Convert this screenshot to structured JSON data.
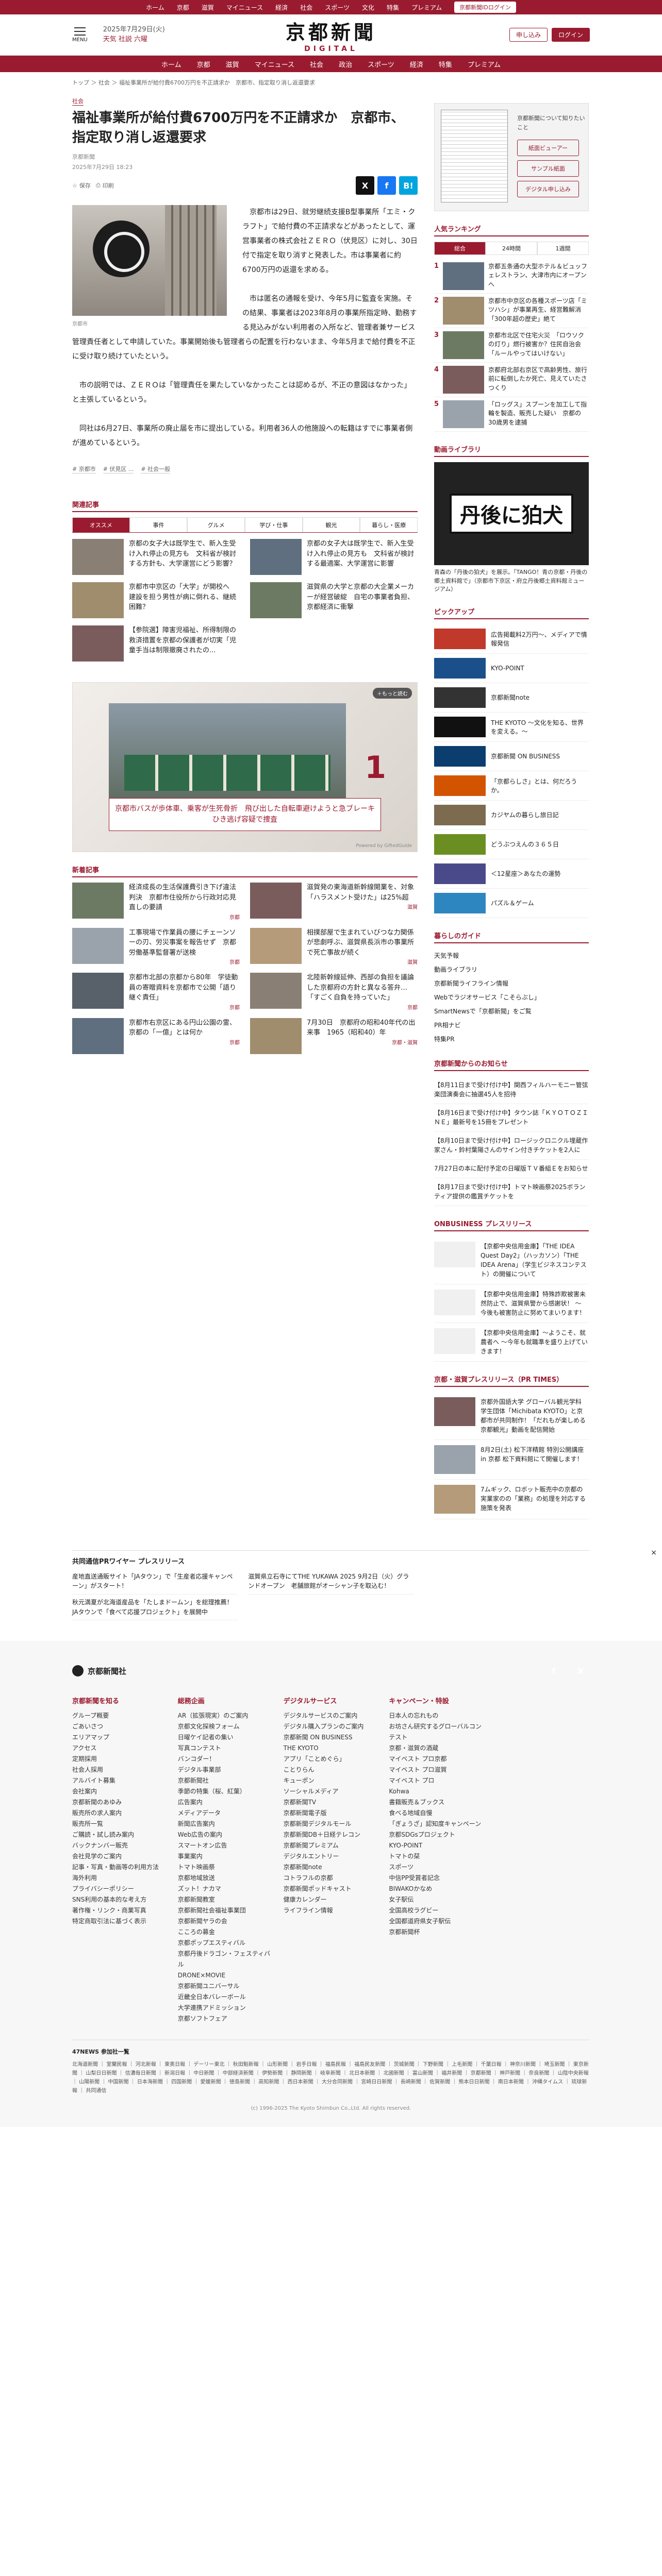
{
  "topnav": {
    "items": [
      "ホーム",
      "京都",
      "滋賀",
      "マイニュース",
      "経済",
      "社会",
      "スポーツ",
      "文化",
      "特集",
      "プレミアム"
    ],
    "login": "京都新聞IDログイン"
  },
  "header": {
    "menu": "MENU",
    "date": "2025年7月29日(火)",
    "weather_loc": "天気 社説 六曜",
    "logo": "京都新聞",
    "logo_sub": "DIGITAL",
    "subscribe": "申し込み",
    "login": "ログイン"
  },
  "catnav": [
    "ホーム",
    "京都",
    "滋賀",
    "マイニュース",
    "社会",
    "政治",
    "スポーツ",
    "経済",
    "特集",
    "プレミアム"
  ],
  "breadcrumb": "トップ ＞ 社会 ＞ 福祉事業所が給付費6700万円を不正請求か　京都市、指定取り消し返還要求",
  "article": {
    "tag": "社会",
    "title": "福祉事業所が給付費6700万円を不正請求か　京都市、指定取り消し返還要求",
    "author": "京都新聞",
    "date": "2025年7月29日 18:23",
    "save": "保存",
    "print": "印刷",
    "photo_caption": "京都市",
    "paragraphs": [
      "京都市は29日、就労継続支援B型事業所「エミ・クラフト」で給付費の不正請求などがあったとして、運営事業者の株式会社ＺＥＲＯ（伏見区）に対し、30日付で指定を取り消すと発表した。市は事業者に約6700万円の返還を求める。",
      "市は匿名の通報を受け、今年5月に監査を実施。その結果、事業者は2023年8月の事業所指定時、勤務する見込みがない利用者の入所など、管理者兼サービス管理責任者として申請していた。事業開始後も管理者らの配置を行わないまま、今年5月まで給付費を不正に受け取り続けていたという。",
      "市の説明では、ＺＥＲＯは「管理責任を果たしていなかったことは認めるが、不正の意図はなかった」と主張しているという。",
      "同社は6月27日、事業所の廃止届を市に提出している。利用者36人の他施設への転籍はすでに事業者側が進めているという。"
    ],
    "tags": [
      "# 京都市",
      "# 伏見区 ...",
      "# 社会一般"
    ]
  },
  "related": {
    "heading": "関連記事",
    "tabs": [
      "オススメ",
      "事件",
      "グルメ",
      "学び・仕事",
      "観光",
      "暮らし・医療"
    ],
    "items": [
      "京都の女子大は既学生で、新入生受け入れ停止の見方も　文科省が検討する方針も、大学運営にどう影響？",
      "京都の女子大は既学生で、新入生受け入れ停止の見方も　文科省が検討する最適案、大学運営に影響",
      "京都市中京区の「大学」が開校へ　建設を担う男性が病に倒れる、継続困難？",
      "滋賀県の大学と京都の大企業メーカーが経営破綻　自宅の事業者負担、京都経済に衝撃",
      "【参院選】障害児福祉、所得制限の救済措置を京都の保護者が切実「児童手当は制限撤廃されたの..."
    ]
  },
  "video": {
    "more": "＋もっと読む",
    "caption": "京都市バスが歩体車、乗客が生死骨折　飛び出した自転車避けようと急ブレーキ　ひき逃げ容疑で捜査",
    "number": "1",
    "powered": "Powered by GiftedGuide"
  },
  "latest": {
    "heading": "新着記事",
    "items": [
      {
        "t": "経済成長の生活保護費引き下げ違法判決　京都市住役所から行政対応見直しの要請",
        "c": "京都"
      },
      {
        "t": "滋賀発の東海道新幹線開業を、対象「ハラスメント受けた」は25%超",
        "c": "滋賀"
      },
      {
        "t": "工事現場で作業員の腰にチェーンソーの刃、労災事案を報告せず　京都労働基準監督署が送検",
        "c": "京都"
      },
      {
        "t": "相撲部屋で生まれていびつな力関係が悲劇呼ぶ、滋賀県長浜市の事業所で死亡事故が続く",
        "c": "滋賀"
      },
      {
        "t": "京都市北部の京都から80年　学徒動員の寄贈資料を京都市で公開「語り継ぐ責任」",
        "c": "京都"
      },
      {
        "t": "北陸新幹線延伸、西部の負担を議論した京都府の方針と異なる答弁…「すごく自負を持っていた」",
        "c": "京都"
      },
      {
        "t": "京都市右京区にある円山公園の霊、京都の「一億」とは何か",
        "c": "京都"
      },
      {
        "t": "7月30日　京都府の昭和40年代の出来事　1965（昭和40）年",
        "c": "京都・滋賀"
      }
    ]
  },
  "side": {
    "paper_desc": "京都新聞について知りたいこと",
    "btn1": "紙面ビューアー",
    "btn2": "サンプル紙面",
    "btn3": "デジタル申し込み",
    "ranking_heading": "人気ランキング",
    "ranking_tabs": [
      "総合",
      "24時間",
      "1週間"
    ],
    "ranking": [
      "京都五条通の大型ホテル＆ビュッフェレストラン、大津市内にオープンへ",
      "京都市中京区の各種スポーツ店「ミツハシ」が事業再生、経営難解消「300年超の歴史」絶て",
      "京都市北区で住宅火災　「ロウソクの灯り」燃行被害か？住民自治会「ルールやってはいけない」",
      "京都府北部右京区で高齢男性、旅行前に転倒したか死亡、見えていたさつくり",
      "「ロッグス」スプーンを加工して指輪を製造、販売した疑い　京都の30歳男を逮捕"
    ],
    "ranking_nums": [
      "1",
      "2",
      "3",
      "4",
      "5"
    ],
    "movie_heading": "動画ライブラリ",
    "movie_title": "丹後に狛犬",
    "movie_desc": "青森の「丹後の狛犬」を展示。「TANGO！青の京都・丹後の郷土資料館で」（京都市下京区・府立丹後郷土資料館ミュージアム）",
    "pickup_heading": "ピックアップ",
    "pickups": [
      "広告掲載料2万円〜、メディアで情報発信",
      "KYO-POINT",
      "京都新聞note",
      "THE KYOTO 〜文化を知る、世界を変える。〜",
      "京都新聞 ON BUSINESS",
      "「京都らしさ」とは、何だろうか。",
      "カジヤムの暮らし旅日記",
      "どうぶつえんの３６５日",
      "＜12星座＞あなたの運勢",
      "パズル＆ゲーム"
    ],
    "guide_heading": "暮らしのガイド",
    "guides": [
      "天気予報",
      "動画ライブラリ",
      "京都新聞ライフライン情報",
      "Webでラジオサービス「こそらぶし」",
      "SmartNewsで「京都新聞」をご覧",
      "PR相ナビ",
      "特集PR"
    ],
    "notice_heading": "京都新聞からのお知らせ",
    "notices": [
      "【8月11日まで受け付け中】関西フィルハーモニー管弦楽団演奏会に抽選45人を招待",
      "【8月16日まで受け付け中】タウン誌「ＫＹＯＴＯＺＩＮＥ」最新号を15冊をプレゼント",
      "【8月10日まで受け付け中】ロージックロニクル埋蔵作家さん・鈴村葉陽さんのサイン付きチケットを2人に",
      "7月27日の本に配付予定の日曜版ＴＶ番組Ｅをお知らせ",
      "【8月17日まで受け付け中】トマト映画祭2025ボランティア提供の鑑賞チケットを"
    ],
    "onbusiness_heading": "ONBUSINESS プレスリリース",
    "onbusiness": [
      "【京都中央信用金庫】「THE IDEA Quest Day2」（ハッカソン）「THE IDEA Arena」（学生ビジネスコンテスト）の開催について",
      "【京都中央信用金庫】特殊詐欺被害未然防止で、滋賀県警から感謝状！ 〜 今後も被害防止に努めてまいります！",
      "【京都中央信用金庫】〜ようこそ、就農者へ 〜今年も就職準を盛り上げていきます！"
    ],
    "prtimes_heading": "京都・滋賀プレスリリース（PR TIMES）",
    "prtimes": [
      "京都外国語大学 グローバル観光学科 学生団体「Michibata KYOTO」と京都市が共同制作！「だれもが楽しめる京都観光」動画を配信開始",
      "8月2日(土) 松下洋精館 特別公開講座 in 京都 松下資料館にて開催します！",
      "7ムギック、ロボット販売中の京都の実業家のの「業務」の処理を対応する施策を発表"
    ]
  },
  "ad_strip": {
    "heading": "共同通信PRワイヤー プレスリリース",
    "cols": [
      [
        "産地直送通販サイト「JAタウン」で「生産者応援キャンペーン」がスタート！",
        "秋元満夏が北海道産品を「たしまドームン」を総理推薦！ JAタウンで「食べて応援プロジェクト」を展開中"
      ],
      [
        "滋賀県立石寺にてTHE YUKAWA 2025 9月2日（火）グランドオープン　老舗旅館がオーシャン子を取込む！"
      ],
      []
    ],
    "close": "×"
  },
  "footer": {
    "brand": "京都新聞社",
    "sns": [
      "f",
      "X"
    ],
    "cols": [
      {
        "h": "京都新聞を知る",
        "items": [
          "グループ概要",
          "ごあいさつ",
          "エリアマップ",
          "アクセス",
          "定期採用",
          "社会人採用",
          "アルバイト募集",
          "会社案内",
          "京都新聞のあゆみ",
          "販売所の求人案内",
          "販売所一覧",
          "ご購読・試し読み案内",
          "バックナンバー販売",
          "会社見学のご案内",
          "記事・写真・動画等の利用方法",
          "海外利用",
          "プライバシーポリシー",
          "SNS利用の基本的な考え方",
          "著作権・リンク・商業写真",
          "特定商取引法に基づく表示"
        ]
      },
      {
        "h": "総務企画",
        "items": [
          "AR（拡張現実）のご案内",
          "京都文化探検フォーム",
          "日曜ケイ記者の集い",
          "写真コンテスト",
          "バンコダー！",
          "デジタル事業部",
          "京都新聞社",
          "季節の特集（桜、紅葉）",
          "広告案内",
          "メディアデータ",
          "新聞広告案内",
          "Web広告の案内",
          "スマートオン広告",
          "事業案内",
          "トマト映画祭",
          "京都地域放送",
          "ズット！ナカマ",
          "京都新聞教室",
          "京都新聞社会福祉事業団",
          "京都新聞ヤラの会",
          "こころの募金",
          "京都ポップエスティバル",
          "京都丹後ドラゴン・フェスティバル",
          "DRONE×MOVIE",
          "京都新聞ユニバーサル",
          "近畿全日本バレーボール",
          "大学連携アドミッション",
          "京都ソフトフェア"
        ]
      },
      {
        "h": "デジタルサービス",
        "items": [
          "デジタルサービスのご案内",
          "デジタル購入プランのご案内",
          "京都新聞 ON BUSINESS",
          "THE KYOTO",
          "アプリ「ことめぐら」",
          "ことりらん",
          "キューポン",
          "ソーシャルメディア",
          "京都新聞TV",
          "京都新聞電子版",
          "京都新聞デジタルモール",
          "京都新聞DB＋日経テレコン",
          "京都新聞プレミアム",
          "デジタルエントリー",
          "京都新聞note",
          "コトラフルの京都",
          "京都新聞ポッドキャスト",
          "健康カレンダー",
          "ライフライン情報"
        ]
      },
      {
        "h": "キャンペーン・特設",
        "items": [
          "日本人の忘れもの",
          "お坊さん研究するグローバルコンテスト",
          "京都・滋賀の酒蔵",
          "マイベスト プロ京都",
          "マイベスト プロ滋賀",
          "マイベスト プロ",
          "Kohwa",
          "書籍販売＆ブックス",
          "食べる地域自慢",
          "「ぎょうざ」認知度キャンペーン",
          "京都SDGsプロジェクト",
          "KYO-POINT",
          "トマトの栞",
          "スポーツ",
          "中信PP受賞者記念",
          "BIWAKOかなめ",
          "女子駅伝",
          "全国高校ラグビー",
          "全国都道府県女子駅伝",
          "京都新聞杯"
        ]
      },
      {
        "h": "",
        "items": []
      }
    ],
    "sites_heading": "47NEWS 参加社一覧",
    "sites": "北海道新聞 ｜ 室蘭民報 ｜ 河北新報 ｜ 東奥日報 ｜ デーリー東北 ｜ 秋田魁新報 ｜ 山形新聞 ｜ 岩手日報 ｜ 福島民報 ｜ 福島民友新聞 ｜ 茨城新聞 ｜ 下野新聞 ｜ 上毛新聞 ｜ 千葉日報 ｜ 神奈川新聞 ｜ 埼玉新聞 ｜ 東京新聞 ｜ 山梨日日新聞 ｜ 信濃毎日新聞 ｜ 新潟日報 ｜ 中日新聞 ｜ 中部経済新聞 ｜ 伊勢新聞 ｜ 静岡新聞 ｜ 岐阜新聞 ｜ 北日本新聞 ｜ 北國新聞 ｜ 富山新聞 ｜ 福井新聞 ｜ 京都新聞 ｜ 神戸新聞 ｜ 奈良新聞 ｜ 山陰中央新報 ｜ 山陽新聞 ｜ 中国新聞 ｜ 日本海新聞 ｜ 四国新聞 ｜ 愛媛新聞 ｜ 徳島新聞 ｜ 高知新聞 ｜ 西日本新聞 ｜ 大分合同新聞 ｜ 宮崎日日新聞 ｜ 長崎新聞 ｜ 佐賀新聞 ｜ 熊本日日新聞 ｜ 南日本新聞 ｜ 沖縄タイムス ｜ 琉球新報 ｜ 共同通信",
    "copyright": "(c) 1996-2025 The Kyoto Shimbun Co.,Ltd. All rights reserved."
  },
  "colors": {
    "brand": "#9a1b2f"
  }
}
